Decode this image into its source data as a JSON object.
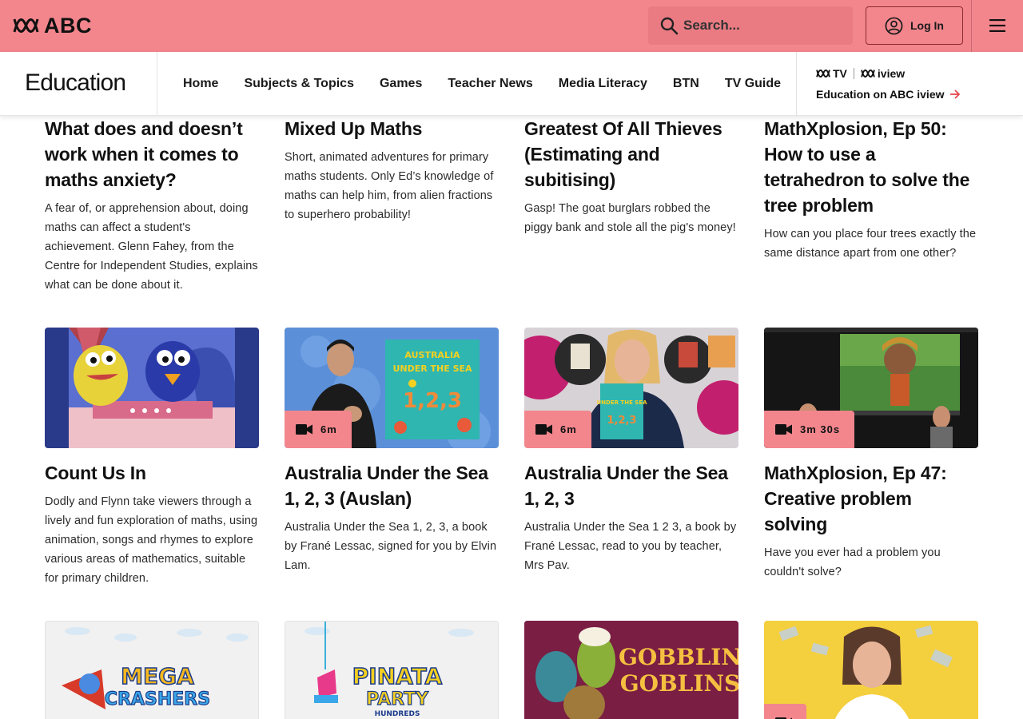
{
  "header": {
    "brand": "ABC",
    "search_placeholder": "Search...",
    "login_label": "Log In"
  },
  "edunav": {
    "title": "Education",
    "links": [
      "Home",
      "Subjects & Topics",
      "Games",
      "Teacher News",
      "Media Literacy",
      "BTN",
      "TV Guide"
    ],
    "iview_logo_tv": "TV",
    "iview_logo_iview": "iview",
    "iview_link": "Education on ABC iview"
  },
  "row1": [
    {
      "title": "What does and doesn’t work when it comes to maths anxiety?",
      "desc": "A fear of, or apprehension about, doing maths can affect a student's achievement. Glenn Fahey, from the Centre for Independent Studies, explains what can be done about it."
    },
    {
      "title": "Mixed Up Maths",
      "desc": "Short, animated adventures for primary maths students. Only Ed’s knowledge of maths can help him, from alien fractions to superhero probability!"
    },
    {
      "title": "Greatest Of All Thieves (Estimating and subitising)",
      "desc": "Gasp! The goat burglars robbed the piggy bank and stole all the pig's money!"
    },
    {
      "title": "MathXplosion, Ep 50: How to use a tetrahedron to solve the tree problem",
      "desc": "How can you place four trees exactly the same distance apart from one other?"
    }
  ],
  "row2": [
    {
      "title": "Count Us In",
      "desc": "Dodly and Flynn take viewers through a lively and fun exploration of maths, using animation, songs and rhymes to explore various areas of mathematics, suitable for primary children.",
      "duration": ""
    },
    {
      "title": "Australia Under the Sea 1, 2, 3 (Auslan)",
      "desc": "Australia Under the Sea 1, 2, 3, a book by Frané Lessac, signed for you by Elvin Lam.",
      "duration": "6m",
      "thumb_book_title_1": "AUSTRALIA",
      "thumb_book_title_2": "UNDER THE SEA",
      "thumb_book_num": "1,2,3"
    },
    {
      "title": "Australia Under the Sea 1, 2, 3",
      "desc": "Australia Under the Sea 1 2 3, a book by Frané Lessac, read to you by teacher, Mrs Pav.",
      "duration": "6m"
    },
    {
      "title": "MathXplosion, Ep 47: Creative problem solving",
      "desc": "Have you ever had a problem you couldn't solve?",
      "duration": "3m 30s"
    }
  ],
  "row3": [
    {
      "thumb_text_1": "MEGA",
      "thumb_text_2": "CRASHERS"
    },
    {
      "thumb_text_1": "PINATA",
      "thumb_text_2": "PARTY",
      "thumb_text_3": "HUNDREDS"
    },
    {
      "thumb_text_1": "GOBBLIN",
      "thumb_text_2": "GOBLINS"
    },
    {}
  ],
  "colors": {
    "topbar": "#f3868d",
    "accent": "#f3868d"
  }
}
